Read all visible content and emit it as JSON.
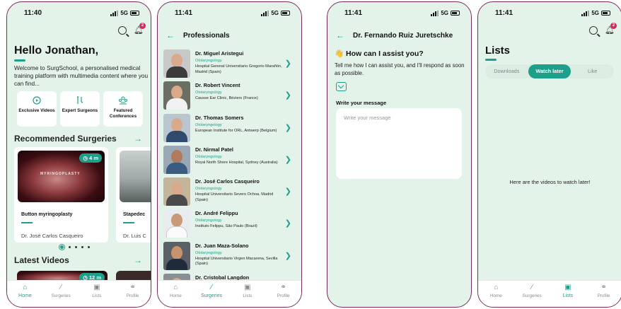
{
  "colors": {
    "accent": "#1d9f8c",
    "background": "#e4f3ea",
    "notification": "#e0245e",
    "frame": "#7b2a5e"
  },
  "screens": {
    "home": {
      "time": "11:40",
      "network": "5G",
      "notification_count": "2",
      "greeting": "Hello Jonathan,",
      "welcome": "Welcome to SurgSchool, a personalised medical training platform with multimedia content where you can find...",
      "tiles": [
        {
          "icon": "play-circle-icon",
          "label": "Exclusive Videos"
        },
        {
          "icon": "surgical-tools-icon",
          "label": "Expert Surgeons"
        },
        {
          "icon": "conference-icon",
          "label": "Featured Conferences"
        }
      ],
      "recommended_title": "Recommended Surgeries",
      "cards": [
        {
          "duration": "4 m",
          "watermark": "MYRINGOPLASTY",
          "title": "Button myringoplasty",
          "author": "Dr. José Carlos Casqueiro"
        },
        {
          "title": "Stapedec",
          "author": "Dr. Luis C"
        }
      ],
      "latest_title": "Latest Videos",
      "latest_duration": "12 m"
    },
    "professionals": {
      "time": "11:41",
      "network": "5G",
      "title": "Professionals",
      "items": [
        {
          "name": "Dr. Miguel Aristegui",
          "specialty": "Otolaryngology",
          "place": "Hospital General Universitario Gregorio Marañón, Madrid (Spain)"
        },
        {
          "name": "Dr. Robert Vincent",
          "specialty": "Otolaryngology",
          "place": "Causse Ear Clinic, Béziers (France)"
        },
        {
          "name": "Dr. Thomas Somers",
          "specialty": "Otolaryngology",
          "place": "European Institute for ORL, Antwerp (Belgium)"
        },
        {
          "name": "Dr. Nirmal Patel",
          "specialty": "Otolaryngology",
          "place": "Royal North Shore Hospital, Sydney (Australia)"
        },
        {
          "name": "Dr. José Carlos Casqueiro",
          "specialty": "Otolaryngology",
          "place": "Hospital Universitario Severo Ochoa, Madrid (Spain)"
        },
        {
          "name": "Dr. André Felippu",
          "specialty": "Otolaryngology",
          "place": "Instituto Felippu, São Paulo (Brazil)"
        },
        {
          "name": "Dr. Juan Maza-Solano",
          "specialty": "Otolaryngology",
          "place": "Hospital Universitario Virgen Macarena, Sevilla (Spain)"
        },
        {
          "name": "Dr. Cristobal Langdon",
          "specialty": "",
          "place": ""
        }
      ]
    },
    "contact": {
      "time": "11:41",
      "network": "5G",
      "title": "Dr. Fernando Ruiz Juretschke",
      "heading": "👋 How can I assist you?",
      "body": "Tell me how I can assist you, and I'll respond as soon as possible.",
      "field_label": "Write your message",
      "field_placeholder": "Write your message"
    },
    "lists": {
      "time": "11:41",
      "network": "5G",
      "notification_count": "2",
      "title": "Lists",
      "segments": [
        "Downloads",
        "Watch later",
        "Like"
      ],
      "empty_message": "Here are the videos to watch later!"
    }
  },
  "tabbar": {
    "home": "Home",
    "surgeries": "Surgeries",
    "lists": "Lists",
    "profile": "Profile"
  }
}
